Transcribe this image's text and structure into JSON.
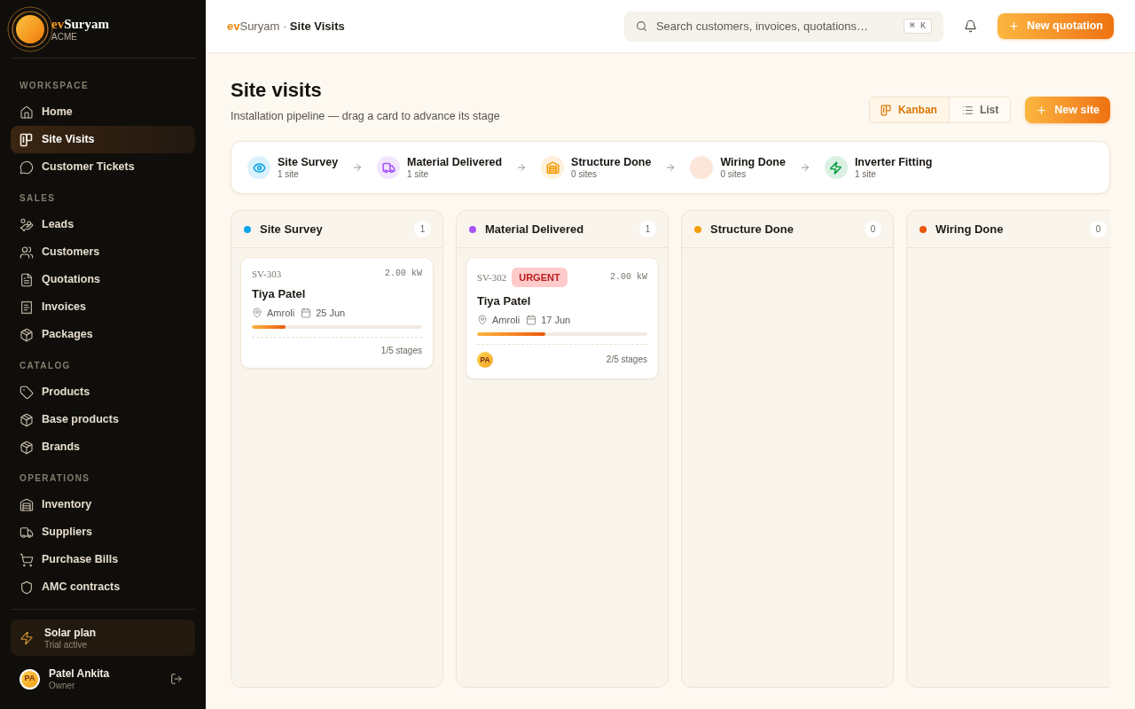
{
  "sidebar": {
    "brand": {
      "prefix": "ev",
      "name": "Suryam",
      "org": "ACME"
    },
    "sections": [
      {
        "label": "WORKSPACE",
        "items": [
          {
            "label": "Home",
            "selected": false
          },
          {
            "label": "Site Visits",
            "selected": true
          },
          {
            "label": "Customer Tickets",
            "selected": false
          }
        ]
      },
      {
        "label": "SALES",
        "items": [
          {
            "label": "Leads",
            "selected": false
          },
          {
            "label": "Customers",
            "selected": false
          },
          {
            "label": "Quotations",
            "selected": false
          },
          {
            "label": "Invoices",
            "selected": false
          },
          {
            "label": "Packages",
            "selected": false
          }
        ]
      },
      {
        "label": "CATALOG",
        "items": [
          {
            "label": "Products",
            "selected": false
          },
          {
            "label": "Base products",
            "selected": false
          },
          {
            "label": "Brands",
            "selected": false
          }
        ]
      },
      {
        "label": "OPERATIONS",
        "items": [
          {
            "label": "Inventory",
            "selected": false
          },
          {
            "label": "Suppliers",
            "selected": false
          },
          {
            "label": "Purchase Bills",
            "selected": false
          },
          {
            "label": "AMC contracts",
            "selected": false
          }
        ]
      }
    ],
    "plan": {
      "title": "Solar plan",
      "status": "Trial active"
    },
    "user": {
      "initials": "PA",
      "name": "Patel Ankita",
      "role": "Owner"
    }
  },
  "header": {
    "breadcrumb": {
      "brand_prefix": "ev",
      "brand_name": "Suryam",
      "separator": "·",
      "current": "Site Visits"
    },
    "search": {
      "placeholder": "Search customers, invoices, quotations…",
      "shortcut": "⌘ K"
    },
    "new_button": "New quotation"
  },
  "page": {
    "title": "Site visits",
    "subtitle": "Installation pipeline — drag a card to advance its stage",
    "views": [
      {
        "label": "Kanban",
        "selected": true
      },
      {
        "label": "List",
        "selected": false
      }
    ],
    "new_button": "New site"
  },
  "stages": [
    {
      "title": "Site Survey",
      "count": "1 site",
      "color": "#0ea5e9"
    },
    {
      "title": "Material Delivered",
      "count": "1 site",
      "color": "#a855f7"
    },
    {
      "title": "Structure Done",
      "count": "0 sites",
      "color": "#f59e0b"
    },
    {
      "title": "Wiring Done",
      "count": "0 sites",
      "color": "#fce6da"
    },
    {
      "title": "Inverter Fitting",
      "count": "1 site",
      "color": "#16a34a"
    }
  ],
  "columns": [
    {
      "name": "Site Survey",
      "color": "#0ea5e9",
      "count": "1",
      "cards": [
        {
          "id": "SV-303",
          "capacity": "2.00 kW",
          "customer": "Tiya Patel",
          "location": "Amroli",
          "date": "25 Jun",
          "level": 0.2,
          "progress": "1/5 stages"
        }
      ]
    },
    {
      "name": "Material Delivered",
      "color": "#a855f7",
      "count": "1",
      "cards": [
        {
          "id": "SV-302",
          "tag": "URGENT",
          "capacity": "2.00 kW",
          "customer": "Tiya Patel",
          "location": "Amroli",
          "date": "17 Jun",
          "level": 0.4,
          "progress": "2/5 stages",
          "assignee": "PA"
        }
      ]
    },
    {
      "name": "Structure Done",
      "color": "#f59e0b",
      "count": "0"
    },
    {
      "name": "Wiring Done",
      "color": "#ea580c",
      "count": "0"
    }
  ]
}
